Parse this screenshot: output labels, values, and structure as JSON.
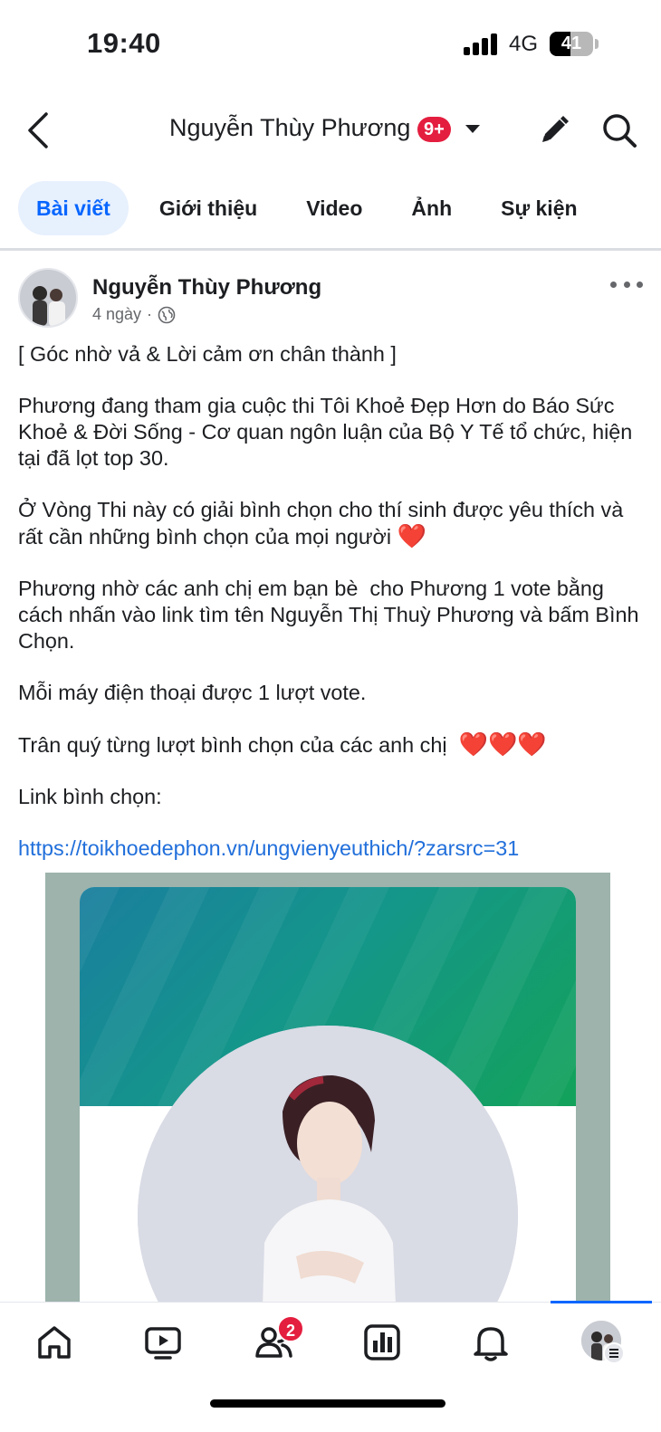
{
  "status_bar": {
    "time": "19:40",
    "network": "4G",
    "battery": "41"
  },
  "header": {
    "title": "Nguyễn Thùy Phương",
    "notification_badge": "9+",
    "icons": [
      "back-icon",
      "caret-down-icon",
      "edit-icon",
      "search-icon"
    ]
  },
  "tabs": [
    {
      "label": "Bài viết",
      "active": true
    },
    {
      "label": "Giới thiệu",
      "active": false
    },
    {
      "label": "Video",
      "active": false
    },
    {
      "label": "Ảnh",
      "active": false
    },
    {
      "label": "Sự kiện",
      "active": false
    }
  ],
  "post": {
    "author": "Nguyễn Thùy Phương",
    "time": "4 ngày",
    "separator": "·",
    "privacy_icon": "globe-icon",
    "paragraphs": {
      "p1": "[ Góc nhờ vả & Lời cảm ơn chân thành ]",
      "p2": "Phương đang tham gia cuộc thi Tôi Khoẻ Đẹp Hơn do Báo Sức Khoẻ & Đời Sống - Cơ quan ngôn luận của Bộ Y Tế tổ chức, hiện tại đã lọt top 30.",
      "p3": "Ở Vòng Thi này có giải bình chọn cho thí sinh được yêu thích và rất cần những bình chọn của mọi người",
      "p4": "Phương nhờ các anh chị em bạn bè  cho Phương 1 vote bằng cách nhấn vào link tìm tên Nguyễn Thị Thuỳ Phương và bấm Bình Chọn.",
      "p5": "Mỗi máy điện thoại được 1 lượt vote.",
      "p6": "Trân quý từng lượt bình chọn của các anh chị",
      "p7": "Link bình chọn:",
      "link": "https://toikhoedephon.vn/ungvienyeuthich/?zarsrc=31"
    },
    "heart_emoji": "❤️"
  },
  "bottom_nav": {
    "items": [
      "home-icon",
      "video-icon",
      "friends-icon",
      "dashboard-icon",
      "bell-icon",
      "profile-avatar"
    ],
    "friends_badge": "2",
    "active_index": 5
  },
  "colors": {
    "accent": "#0866ff",
    "badge": "#e41e3f",
    "link": "#216fdb",
    "active_tab_bg": "#e7f0fd"
  }
}
